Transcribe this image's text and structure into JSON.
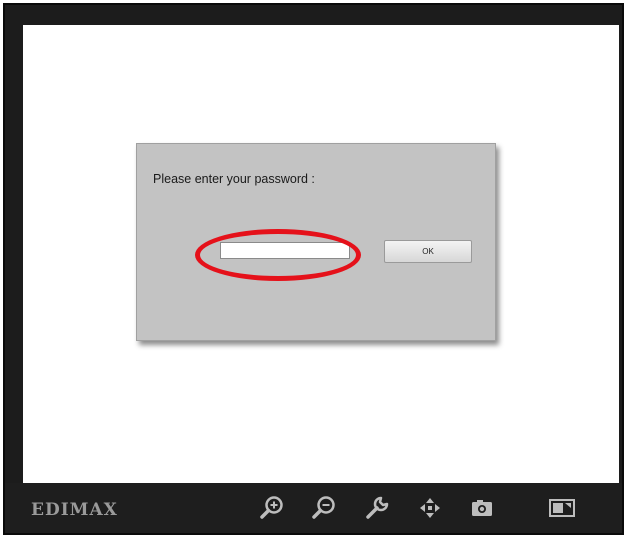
{
  "dialog": {
    "prompt": "Please enter your password :",
    "password_value": "",
    "ok_label": "OK"
  },
  "toolbar": {
    "brand": "EDIMAX",
    "tools": [
      {
        "name": "zoom-in",
        "icon": "zoom-in-icon"
      },
      {
        "name": "zoom-out",
        "icon": "zoom-out-icon"
      },
      {
        "name": "settings",
        "icon": "wrench-icon"
      },
      {
        "name": "pan",
        "icon": "move-arrows-icon"
      },
      {
        "name": "snapshot",
        "icon": "camera-icon"
      },
      {
        "name": "fullscreen",
        "icon": "fullscreen-icon"
      }
    ]
  },
  "colors": {
    "frame": "#1c1c1c",
    "dialog_bg": "#c3c3c3",
    "highlight_ring": "#e5111a",
    "icon": "#bdbdbd"
  }
}
